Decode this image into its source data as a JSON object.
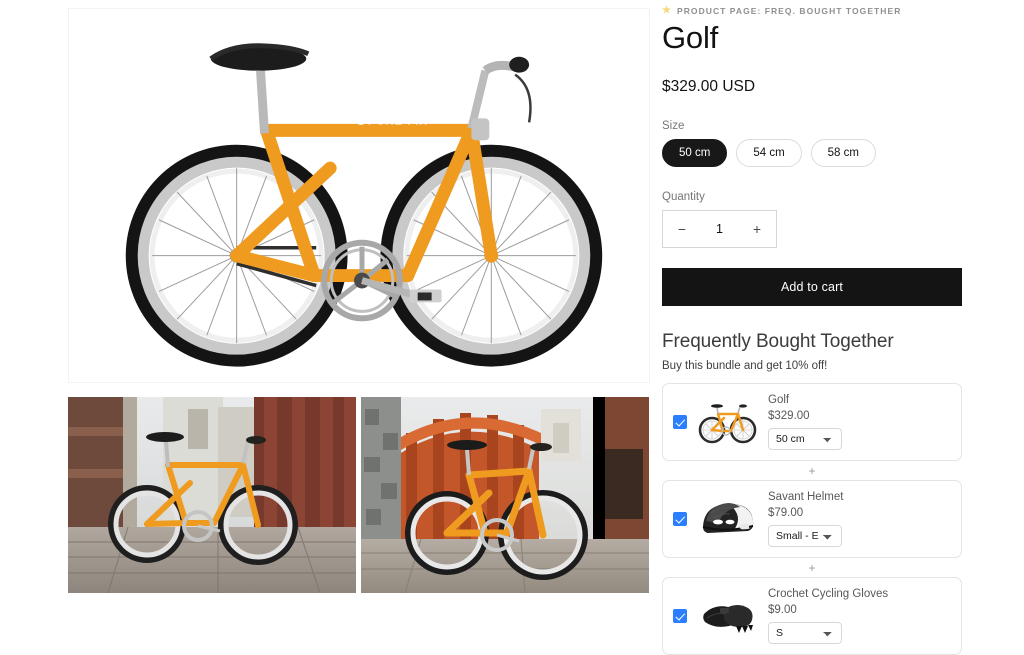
{
  "eyebrow": {
    "icon": "star-icon",
    "text": "PRODUCT PAGE: FREQ. BOUGHT TOGETHER"
  },
  "product": {
    "title": "Golf",
    "price": "$329.00 USD",
    "size_label": "Size",
    "sizes": [
      {
        "label": "50 cm",
        "selected": true
      },
      {
        "label": "54 cm",
        "selected": false
      },
      {
        "label": "58 cm",
        "selected": false
      }
    ],
    "quantity_label": "Quantity",
    "quantity_value": "1",
    "decrease_label": "−",
    "increase_label": "+",
    "add_to_cart_label": "Add to cart"
  },
  "fbt": {
    "title": "Frequently Bought Together",
    "subtitle": "Buy this bundle and get 10% off!",
    "separator": "+",
    "items": [
      {
        "name": "Golf",
        "price": "$329.00",
        "checked": true,
        "variant": "50 cm",
        "thumb": "bicycle-orange-thumb"
      },
      {
        "name": "Savant Helmet",
        "price": "$79.00",
        "checked": true,
        "variant": "Small - E",
        "thumb": "helmet-black-thumb"
      },
      {
        "name": "Crochet Cycling Gloves",
        "price": "$9.00",
        "checked": true,
        "variant": "S",
        "thumb": "gloves-black-thumb"
      }
    ]
  },
  "gallery": {
    "hero": {
      "alt": "Orange Pure Fix single speed bicycle on white background",
      "brand_text": "PURE FIX"
    },
    "thumbnails": [
      {
        "alt": "Orange bicycle parked on wooden bridge deck"
      },
      {
        "alt": "Orange bicycle in front of orange truss bridge"
      }
    ]
  },
  "colors": {
    "frame_orange": "#ef9b20",
    "accent_checkbox": "#2b7fff",
    "button_black": "#141414",
    "pill_selected": "#181818"
  }
}
